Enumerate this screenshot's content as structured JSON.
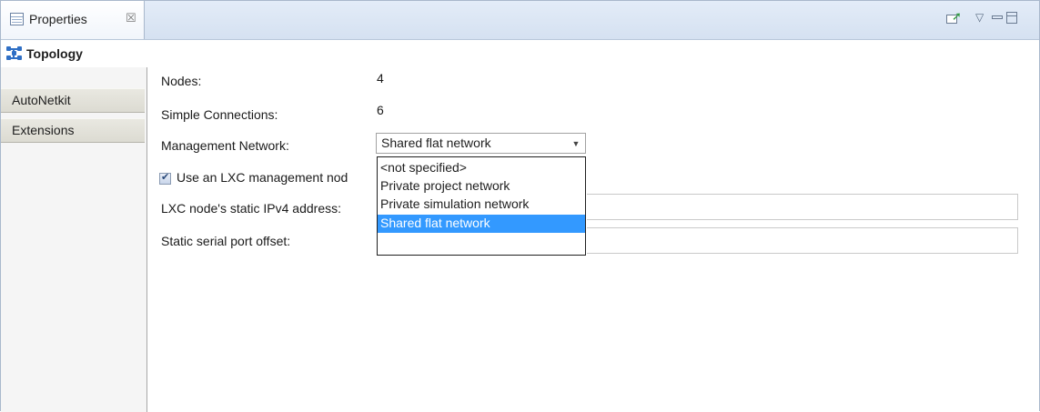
{
  "view": {
    "tab_label": "Properties",
    "close_glyph": "☒"
  },
  "toolbar": {
    "menu_glyph": "▽"
  },
  "sidebar": {
    "items": [
      {
        "label": "Topology",
        "active": true
      },
      {
        "label": "AutoNetkit",
        "active": false
      },
      {
        "label": "Extensions",
        "active": false
      }
    ]
  },
  "form": {
    "nodes_label": "Nodes:",
    "nodes_value": "4",
    "connections_label": "Simple Connections:",
    "connections_value": "6",
    "management_label": "Management Network:",
    "management_value": "Shared flat network",
    "lxc_checkbox_label": "Use an LXC management nod",
    "lxc_checked": true,
    "ipv4_label": "LXC node's static IPv4 address:",
    "serial_label": "Static serial port offset:"
  },
  "dropdown": {
    "options": [
      "<not specified>",
      "Private project network",
      "Private simulation network",
      "Shared flat network"
    ],
    "selected": "Shared flat network"
  },
  "colors": {
    "selection": "#3399ff",
    "titlebar": "#dbe5f3",
    "side_tab": "#e2e1d9"
  }
}
